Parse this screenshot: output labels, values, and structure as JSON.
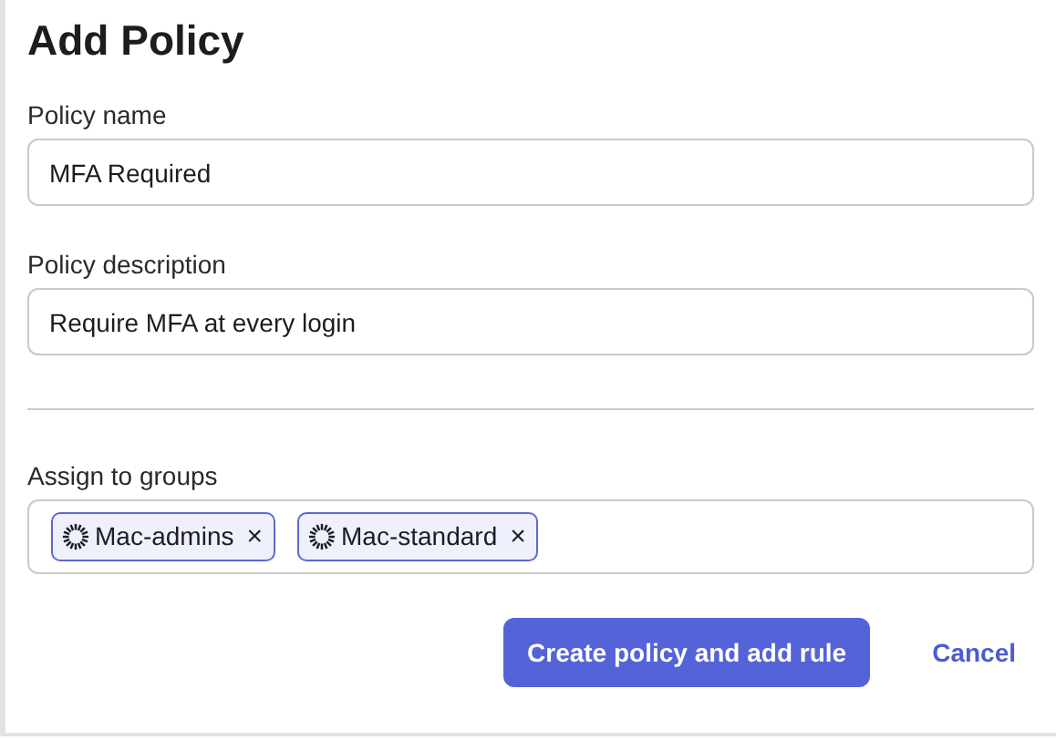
{
  "title": "Add Policy",
  "fields": [
    {
      "label": "Policy name",
      "value": "MFA Required"
    },
    {
      "label": "Policy description",
      "value": "Require MFA at every login"
    }
  ],
  "groups": {
    "label": "Assign to groups",
    "chips": [
      {
        "label": "Mac-admins",
        "remove": "×"
      },
      {
        "label": "Mac-standard",
        "remove": "×"
      }
    ]
  },
  "buttons": [
    {
      "kind": "primary",
      "label": "Create policy and add rule"
    },
    {
      "kind": "link",
      "label": "Cancel"
    }
  ]
}
